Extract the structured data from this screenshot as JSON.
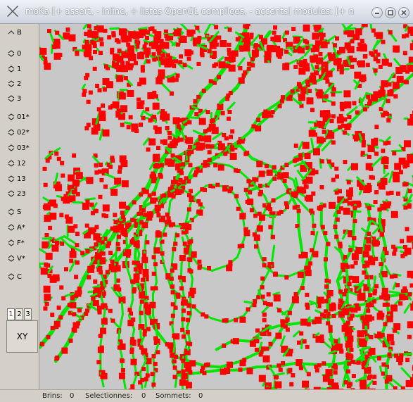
{
  "window": {
    "title": "moKa [+ assert, - inline, + listes OpenGL compilees, - accents] modules: [+ n"
  },
  "sidebar": {
    "items": [
      {
        "label": "B",
        "icon": "chevron-up-icon"
      },
      {
        "label": "0",
        "icon": "chevron-diamond-icon"
      },
      {
        "label": "1",
        "icon": "chevron-diamond-icon"
      },
      {
        "label": "2",
        "icon": "chevron-diamond-icon"
      },
      {
        "label": "3",
        "icon": "chevron-diamond-icon"
      },
      {
        "label": "01*",
        "icon": "chevron-diamond-icon"
      },
      {
        "label": "02*",
        "icon": "chevron-diamond-icon"
      },
      {
        "label": "03*",
        "icon": "chevron-diamond-icon"
      },
      {
        "label": "12",
        "icon": "chevron-diamond-icon"
      },
      {
        "label": "13",
        "icon": "chevron-diamond-icon"
      },
      {
        "label": "23",
        "icon": "chevron-diamond-icon"
      },
      {
        "label": "S",
        "icon": "chevron-diamond-icon"
      },
      {
        "label": "A*",
        "icon": "chevron-diamond-icon"
      },
      {
        "label": "F*",
        "icon": "chevron-diamond-icon"
      },
      {
        "label": "V*",
        "icon": "chevron-diamond-icon"
      },
      {
        "label": "C",
        "icon": "chevron-diamond-icon"
      }
    ],
    "tabs": [
      "1",
      "2",
      "3"
    ],
    "active_tab": "1",
    "view_button": "XY"
  },
  "status": {
    "brins_label": "Brins:",
    "brins_value": "0",
    "selectionnes_label": "Selectionnes:",
    "selectionnes_value": "0",
    "sommets_label": "Sommets:",
    "sommets_value": "0"
  },
  "colors": {
    "edge": "#00e600",
    "dart": "#ff0000",
    "background": "#c8c8c8"
  }
}
